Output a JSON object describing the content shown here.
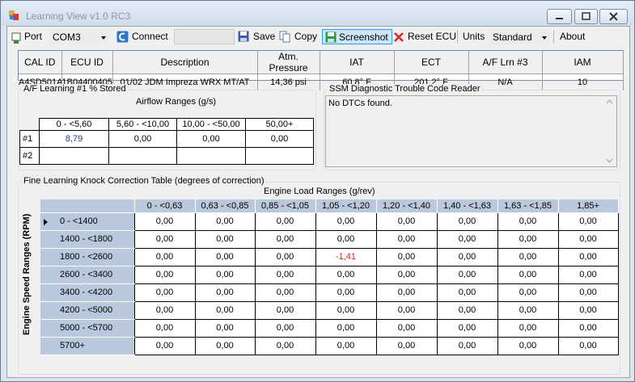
{
  "window": {
    "title": "Learning View v1.0 RC3"
  },
  "toolbar": {
    "port_label": "Port",
    "port_value": "COM3",
    "connect_label": "Connect",
    "connect_status": "",
    "save_label": "Save",
    "copy_label": "Copy",
    "screenshot_label": "Screenshot",
    "reset_label": "Reset ECU",
    "units_label": "Units",
    "units_value": "Standard",
    "about_label": "About"
  },
  "info": {
    "headers": [
      "CAL ID",
      "ECU ID",
      "Description",
      "Atm. Pressure",
      "IAT",
      "ECT",
      "A/F Lrn #3",
      "IAM"
    ],
    "values": [
      "A4SD501A",
      "1B04400405",
      "01/02 JDM Impreza WRX MT/AT",
      "14,36 psi",
      "60,8° F",
      "201,2° F",
      "N/A",
      "10"
    ]
  },
  "af_learning": {
    "title": "A/F Learning #1 % Stored",
    "subtitle": "Airflow Ranges (g/s)",
    "columns": [
      "0 - <5,60",
      "5,60 - <10,00",
      "10,00 - <50,00",
      "50,00+"
    ],
    "rows": [
      {
        "label": "#1",
        "values": [
          "8,79",
          "0,00",
          "0,00",
          "0,00"
        ]
      },
      {
        "label": "#2",
        "values": [
          "",
          "",
          "",
          ""
        ]
      }
    ]
  },
  "dtc": {
    "title": "SSM Diagnostic Trouble Code Reader",
    "text": "No DTCs found."
  },
  "knock": {
    "title": "Fine Learning Knock Correction Table (degrees of correction)",
    "col_axis_label": "Engine Load Ranges (g/rev)",
    "row_axis_label": "Engine Speed Ranges (RPM)",
    "columns": [
      "0 - <0,63",
      "0,63 - <0,85",
      "0,85 - <1,05",
      "1,05 - <1,20",
      "1,20 - <1,40",
      "1,40 - <1,63",
      "1,63 - <1,85",
      "1,85+"
    ],
    "rows": [
      {
        "label": "0 - <1400",
        "values": [
          "0,00",
          "0,00",
          "0,00",
          "0,00",
          "0,00",
          "0,00",
          "0,00",
          "0,00"
        ]
      },
      {
        "label": "1400 - <1800",
        "values": [
          "0,00",
          "0,00",
          "0,00",
          "0,00",
          "0,00",
          "0,00",
          "0,00",
          "0,00"
        ]
      },
      {
        "label": "1800 - <2600",
        "values": [
          "0,00",
          "0,00",
          "0,00",
          "-1,41",
          "0,00",
          "0,00",
          "0,00",
          "0,00"
        ]
      },
      {
        "label": "2600 - <3400",
        "values": [
          "0,00",
          "0,00",
          "0,00",
          "0,00",
          "0,00",
          "0,00",
          "0,00",
          "0,00"
        ]
      },
      {
        "label": "3400 - <4200",
        "values": [
          "0,00",
          "0,00",
          "0,00",
          "0,00",
          "0,00",
          "0,00",
          "0,00",
          "0,00"
        ]
      },
      {
        "label": "4200 - <5000",
        "values": [
          "0,00",
          "0,00",
          "0,00",
          "0,00",
          "0,00",
          "0,00",
          "0,00",
          "0,00"
        ]
      },
      {
        "label": "5000 - <5700",
        "values": [
          "0,00",
          "0,00",
          "0,00",
          "0,00",
          "0,00",
          "0,00",
          "0,00",
          "0,00"
        ]
      },
      {
        "label": "5700+",
        "values": [
          "0,00",
          "0,00",
          "0,00",
          "0,00",
          "0,00",
          "0,00",
          "0,00",
          "0,00"
        ]
      }
    ],
    "negative_color": "#e02020"
  }
}
